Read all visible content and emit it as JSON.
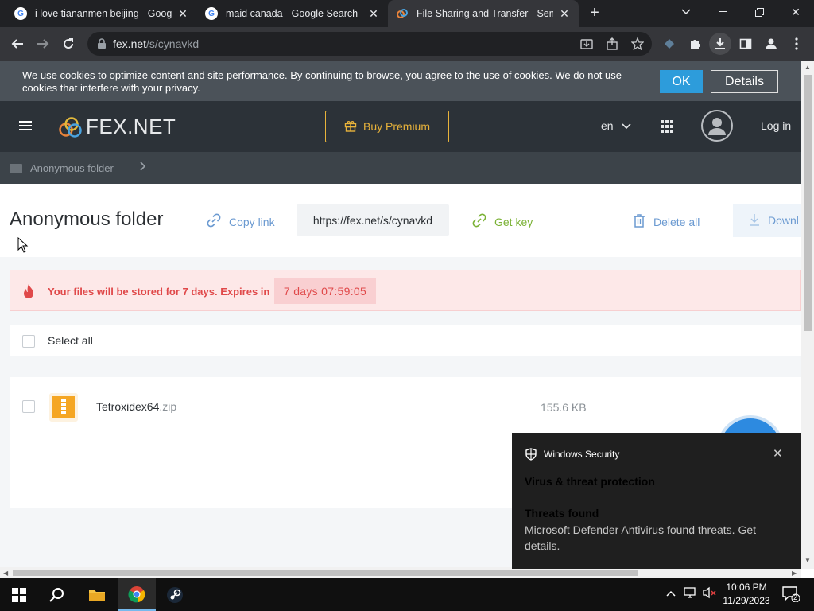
{
  "browser": {
    "tabs": [
      {
        "title": "i love tiananmen beijing - Googl",
        "favicon": "google-g-icon",
        "active": false
      },
      {
        "title": "maid canada - Google Search",
        "favicon": "google-g-icon",
        "active": false
      },
      {
        "title": "File Sharing and Transfer - Send",
        "favicon": "fex-cloud-icon",
        "active": true
      }
    ],
    "url_host": "fex.net",
    "url_path": "/s/cynavkd"
  },
  "cookie_banner": {
    "text": "We use cookies to optimize content and site performance. By continuing to browse, you agree to the use of cookies. We do not use cookies that interfere with your privacy.",
    "ok_label": "OK",
    "details_label": "Details"
  },
  "site": {
    "logo_text": "FEX.NET",
    "premium_label": "Buy Premium",
    "language": "en",
    "login_label": "Log in",
    "colors": {
      "header": "#2c3238",
      "premium": "#e8b33b",
      "accent": "#6b9ad1",
      "green": "#7bb236",
      "alert": "#e0494a"
    }
  },
  "breadcrumb": {
    "folder": "Anonymous folder"
  },
  "folder": {
    "title": "Anonymous folder",
    "copy_link_label": "Copy link",
    "share_link": "https://fex.net/s/cynavkd",
    "get_key_label": "Get key",
    "delete_all_label": "Delete all",
    "download_label": "Downl"
  },
  "expiry": {
    "message": "Your files will be stored for 7 days. Expires in",
    "timer": "7 days  07:59:05"
  },
  "select_all_label": "Select all",
  "files": [
    {
      "name": "Tetroxidex64",
      "ext": ".zip",
      "size": "155.6 KB"
    }
  ],
  "toast": {
    "app": "Windows Security",
    "heading": "Virus & threat protection",
    "subheading": "Threats found",
    "body": "Microsoft Defender Antivirus found threats. Get details."
  },
  "taskbar": {
    "time": "10:06 PM",
    "date": "11/29/2023",
    "notification_count": "2"
  }
}
